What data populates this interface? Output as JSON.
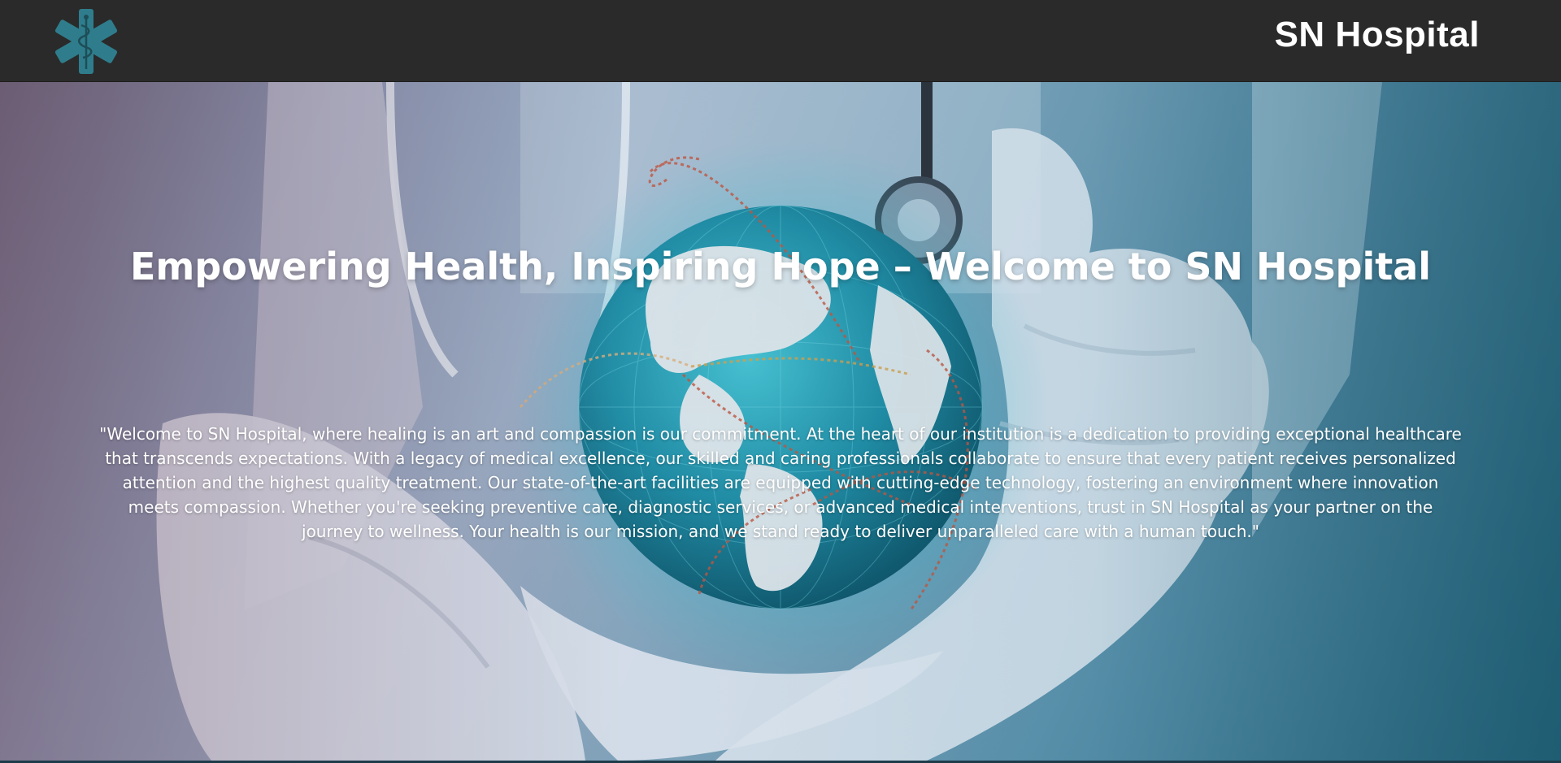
{
  "header": {
    "logo_icon": "star-of-life-icon",
    "brand_name": "SN Hospital"
  },
  "hero": {
    "background_image": "globe-in-gloved-hands-image",
    "headline": "Empowering Health, Inspiring Hope – Welcome to SN Hospital",
    "intro": "\"Welcome to SN Hospital, where healing is an art and compassion is our commitment. At the heart of our institution is a dedication to providing exceptional healthcare that transcends expectations. With a legacy of medical excellence, our skilled and caring professionals collaborate to ensure that every patient receives personalized attention and the highest quality treatment. Our state-of-the-art facilities are equipped with cutting-edge technology, fostering an environment where innovation meets compassion. Whether you're seeking preventive care, diagnostic services, or advanced medical interventions, trust in SN Hospital as your partner on the journey to wellness. Your health is our mission, and we stand ready to deliver unparalleled care with a human touch.\""
  },
  "colors": {
    "navbar_bg": "#2a2a2a",
    "logo_teal": "#2f7d8c",
    "text": "#ffffff"
  }
}
